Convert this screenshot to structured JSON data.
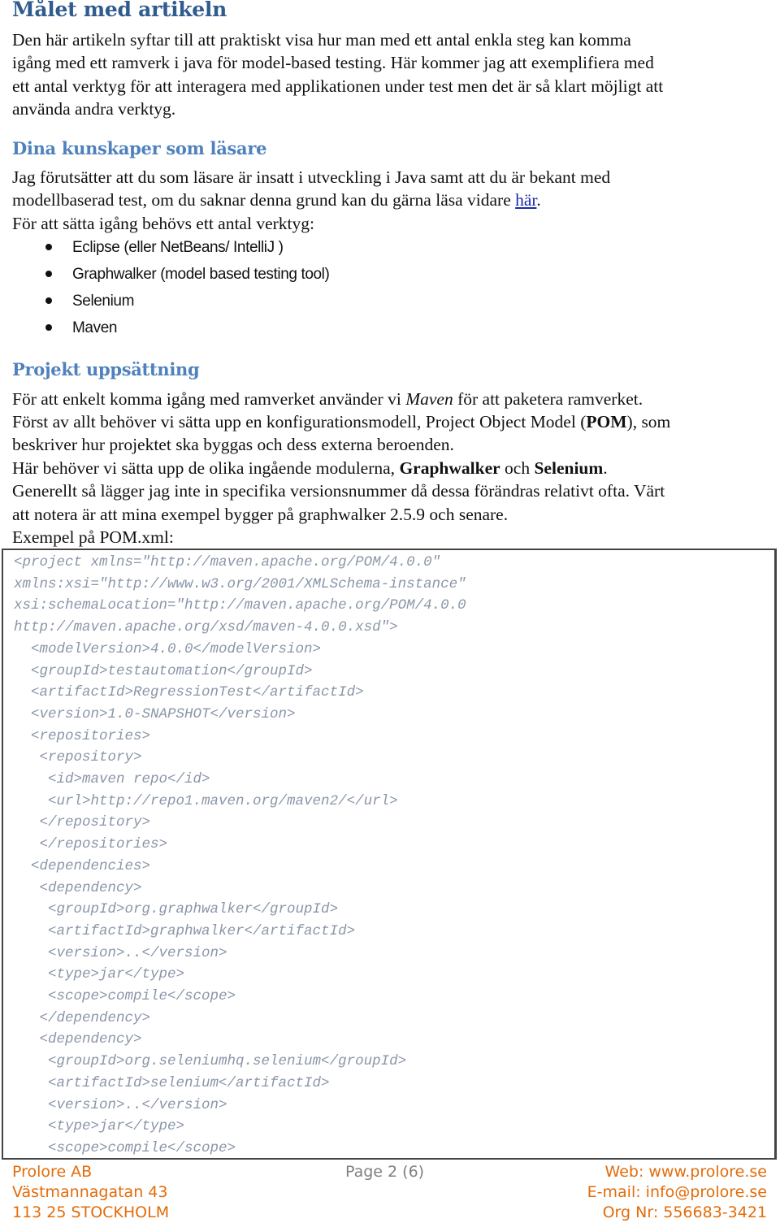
{
  "sections": {
    "goal": {
      "heading": "Målet med artikeln",
      "lines": [
        "Den här artikeln syftar till att praktiskt visa hur man med ett antal enkla steg kan komma",
        "igång med ett ramverk i java för model-based testing. Här kommer jag att exemplifiera  med",
        "ett antal verktyg för att interagera med applikationen under test men det är så klart möjligt att",
        "använda andra verktyg."
      ]
    },
    "knowledge": {
      "heading": "Dina kunskaper som läsare",
      "line1": "Jag förutsätter att du som läsare är insatt i utveckling i Java samt att du är bekant med",
      "line2_prefix": "modellbaserad test, om du saknar denna grund kan du gärna läsa vidare ",
      "line2_link": "här",
      "line2_suffix": ".",
      "line3": "För att sätta igång behövs ett antal verktyg:",
      "tools": [
        "Eclipse (eller NetBeans/ IntelliJ )",
        "Graphwalker (model based testing tool)",
        "Selenium",
        "Maven"
      ]
    },
    "setup": {
      "heading": "Projekt uppsättning",
      "l1_prefix": "För att enkelt komma igång med ramverket använder vi ",
      "l1_italic": "Maven",
      "l1_suffix": " för att paketera ramverket.",
      "l2_prefix": "Först av allt behöver vi sätta upp en konfigurationsmodell, Project Object Model (",
      "l2_bold": "POM",
      "l2_suffix": "), som",
      "l3": "beskriver hur projektet ska byggas och dess externa beroenden.",
      "l4_prefix": "Här behöver vi sätta upp de olika ingående modulerna, ",
      "l4_bold1": "Graphwalker",
      "l4_mid": " och ",
      "l4_bold2": "Selenium",
      "l4_suffix": ".",
      "l5": "Generellt så lägger jag inte in specifika versionsnummer då dessa förändras relativt ofta. Värt",
      "l6": "att notera är att mina exempel bygger på graphwalker 2.5.9 och senare.",
      "l7": "Exempel på POM.xml:"
    }
  },
  "code": [
    "<project xmlns=\"http://maven.apache.org/POM/4.0.0\"",
    "xmlns:xsi=\"http://www.w3.org/2001/XMLSchema-instance\"",
    "xsi:schemaLocation=\"http://maven.apache.org/POM/4.0.0",
    "http://maven.apache.org/xsd/maven-4.0.0.xsd\">",
    "  <modelVersion>4.0.0</modelVersion>",
    "  <groupId>testautomation</groupId>",
    "  <artifactId>RegressionTest</artifactId>",
    "  <version>1.0-SNAPSHOT</version>",
    "  <repositories>",
    "   <repository>",
    "    <id>maven repo</id>",
    "    <url>http://repo1.maven.org/maven2/</url>",
    "   </repository>",
    "   </repositories>",
    "  <dependencies>",
    "   <dependency>",
    "    <groupId>org.graphwalker</groupId>",
    "    <artifactId>graphwalker</artifactId>",
    "    <version>..</version>",
    "    <type>jar</type>",
    "    <scope>compile</scope>",
    "   </dependency>",
    "   <dependency>",
    "    <groupId>org.seleniumhq.selenium</groupId>",
    "    <artifactId>selenium</artifactId>",
    "    <version>..</version>",
    "    <type>jar</type>",
    "    <scope>compile</scope>"
  ],
  "footer": {
    "company": "Prolore AB",
    "street": "Västmannagatan 43",
    "city": "113 25 STOCKHOLM",
    "page": "Page 2 (6)",
    "web": "Web: www.prolore.se",
    "email": "E-mail: info@prolore.se",
    "org": "Org Nr: 556683-3421"
  },
  "colors": {
    "heading1": "#2f5b8f",
    "heading2": "#4f81bd",
    "code_text": "#8a96a8",
    "footer_orange": "#e36c0a",
    "footer_grey": "#808080",
    "link": "#1a2aa8"
  }
}
